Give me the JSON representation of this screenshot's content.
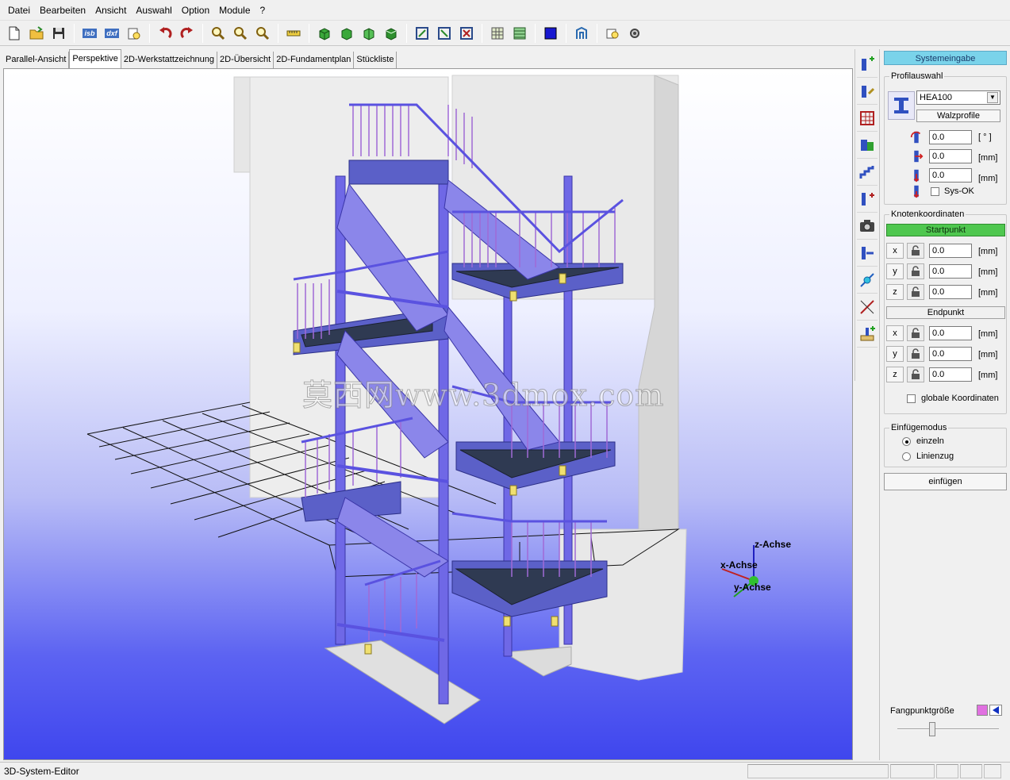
{
  "menubar": {
    "items": [
      "Datei",
      "Bearbeiten",
      "Ansicht",
      "Auswahl",
      "Option",
      "Module",
      "?"
    ]
  },
  "toolbar": {
    "isb_label": "isb",
    "dxf_label": "dxf"
  },
  "tabs": [
    {
      "label": "Parallel-Ansicht",
      "active": false
    },
    {
      "label": "Perspektive",
      "active": true
    },
    {
      "label": "2D-Werkstattzeichnung",
      "active": false
    },
    {
      "label": "2D-Übersicht",
      "active": false
    },
    {
      "label": "2D-Fundamentplan",
      "active": false
    },
    {
      "label": "Stückliste",
      "active": false
    }
  ],
  "viewport": {
    "axes": {
      "z": "z-Achse",
      "x": "x-Achse",
      "y": "y-Achse"
    },
    "watermark": "莫西网www.3dmox.com"
  },
  "panel": {
    "header": "Systemeingabe",
    "profile": {
      "group_title": "Profilauswahl",
      "selected": "HEA100",
      "walzprofile_button": "Walzprofile",
      "rotation_value": "0.0",
      "rotation_unit": "[ ° ]",
      "offset1_value": "0.0",
      "offset1_unit": "[mm]",
      "offset2_value": "0.0",
      "offset2_unit": "[mm]",
      "sysok_label": "Sys-OK"
    },
    "nodes": {
      "group_title": "Knotenkoordinaten",
      "start_label": "Startpunkt",
      "end_label": "Endpunkt",
      "start": [
        {
          "axis": "x",
          "value": "0.0",
          "unit": "[mm]"
        },
        {
          "axis": "y",
          "value": "0.0",
          "unit": "[mm]"
        },
        {
          "axis": "z",
          "value": "0.0",
          "unit": "[mm]"
        }
      ],
      "end": [
        {
          "axis": "x",
          "value": "0.0",
          "unit": "[mm]"
        },
        {
          "axis": "y",
          "value": "0.0",
          "unit": "[mm]"
        },
        {
          "axis": "z",
          "value": "0.0",
          "unit": "[mm]"
        }
      ],
      "global_coords_label": "globale Koordinaten"
    },
    "insert_mode": {
      "group_title": "Einfügemodus",
      "option_single": "einzeln",
      "option_chain": "Linienzug",
      "insert_button": "einfügen"
    },
    "snap": {
      "label": "Fangpunktgröße",
      "slider_fraction": 0.34,
      "snap_color": "#e070e0"
    }
  },
  "statusbar": {
    "text": "3D-System-Editor"
  }
}
